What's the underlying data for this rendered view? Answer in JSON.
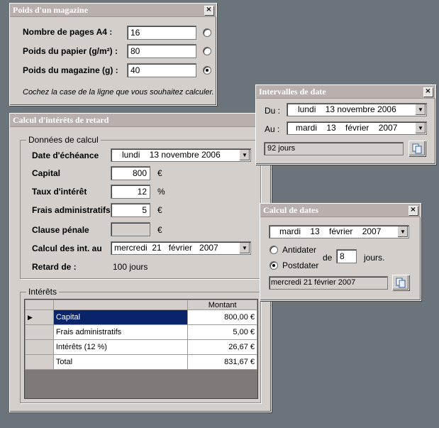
{
  "magazine": {
    "title": "Poids d'un magazine",
    "rows": [
      {
        "label": "Nombre de pages A4 :",
        "value": "16",
        "checked": false
      },
      {
        "label": "Poids du papier (g/m²) :",
        "value": "80",
        "checked": false
      },
      {
        "label": "Poids du magazine (g) :",
        "value": "40",
        "checked": true
      }
    ],
    "hint": "Cochez la case de la ligne que vous souhaitez calculer."
  },
  "interets": {
    "title": "Calcul d'intérêts de retard",
    "group_label": "Données de calcul",
    "echeance_label": "Date d'échéance",
    "echeance_value": "lundi    13 novembre 2006",
    "capital_label": "Capital",
    "capital_value": "800",
    "capital_unit": "€",
    "taux_label": "Taux d'intérêt",
    "taux_value": "12",
    "taux_unit": "%",
    "frais_label": "Frais administratifs",
    "frais_value": "5",
    "frais_unit": "€",
    "clause_label": "Clause pénale",
    "clause_value": "",
    "clause_unit": "€",
    "calcul_label": "Calcul des int. au",
    "calcul_value": "mercredi  21   février   2007",
    "retard_label": "Retard de :",
    "retard_value": "100 jours",
    "table_group_label": "Intérêts",
    "table": {
      "header": "Montant",
      "rows": [
        {
          "name": "Capital",
          "amount": "800,00 €"
        },
        {
          "name": "Frais administratifs",
          "amount": "5,00 €"
        },
        {
          "name": "Intérêts (12 %)",
          "amount": "26,67 €"
        },
        {
          "name": "Total",
          "amount": "831,67 €"
        }
      ]
    }
  },
  "intervalles": {
    "title": "Intervalles de date",
    "du_label": "Du :",
    "du_value": "lundi    13 novembre 2006",
    "au_label": "Au :",
    "au_value": "mardi    13    février    2007",
    "result": "92 jours"
  },
  "calcul_dates": {
    "title": "Calcul de dates",
    "date_value": "mardi    13    février    2007",
    "antidater_label": "Antidater",
    "postdater_label": "Postdater",
    "antidater_checked": false,
    "postdater_checked": true,
    "de_label": "de",
    "days_value": "8",
    "jours_label": "jours.",
    "result": "mercredi 21 février 2007"
  },
  "colors": {
    "desktop": "#6b737b",
    "window": "#d4cfcb",
    "titlebar": "#b9b0ad",
    "selection": "#0a246a"
  }
}
